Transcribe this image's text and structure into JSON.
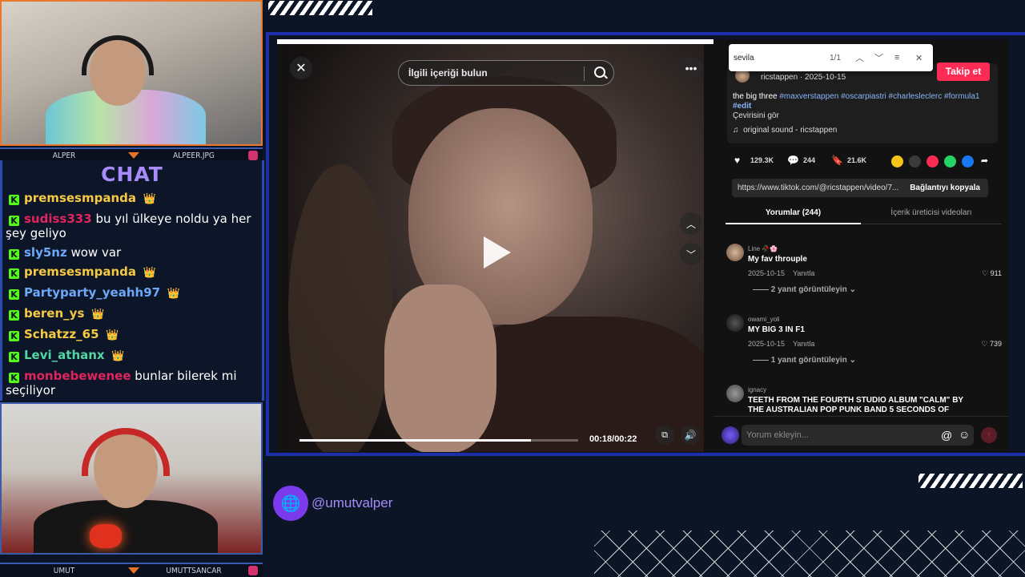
{
  "streamer_top": {
    "name": "ALPER",
    "handle": "ALPEER.JPG"
  },
  "streamer_bottom": {
    "name": "UMUT",
    "handle": "UMUTTSANCAR"
  },
  "chat": {
    "title": "CHAT",
    "messages": [
      {
        "user": "premsesmpanda",
        "text": "",
        "color": "#f6c944"
      },
      {
        "user": "sudiss333",
        "text": "bu yıl ülkeye noldu ya her şey geliyo",
        "color": "#e0245e"
      },
      {
        "user": "sly5nz",
        "text": "wow var",
        "color": "#6ea8f8"
      },
      {
        "user": "premsesmpanda",
        "text": "",
        "color": "#f6c944"
      },
      {
        "user": "Partyparty_yeahh97",
        "text": "",
        "color": "#6ea8f8"
      },
      {
        "user": "beren_ys",
        "text": "",
        "color": "#f6c944"
      },
      {
        "user": "Schatzz_65",
        "text": "",
        "color": "#f6c944"
      },
      {
        "user": "Levi_athanx",
        "text": "",
        "color": "#53d6a3"
      },
      {
        "user": "monbebewenee",
        "text": "bunlar bilerek mi seçiliyor",
        "color": "#e0245e"
      }
    ]
  },
  "video": {
    "search_placeholder": "İlgili içeriği bulun",
    "time": "00:18/00:22",
    "progress": 0.83
  },
  "find_bar": {
    "query": "sevila",
    "count": "1/1"
  },
  "post": {
    "author_date": "ricstappen · 2025-10-15",
    "caption_prefix": "the big three ",
    "hashtags_line1": "#maxverstappen #oscarpiastri #charlesleclerc #formula1",
    "hashtags_line2": "#edit",
    "translate": "Çevirisini gör",
    "sound": "original sound - ricstappen",
    "follow_label": "Takip et",
    "likes": "129.3K",
    "comments": "244",
    "saves": "21.6K",
    "link": "https://www.tiktok.com/@ricstappen/video/7...",
    "copy_link": "Bağlantıyı kopyala"
  },
  "tabs": {
    "comments": "Yorumlar (244)",
    "creator_videos": "İçerik üreticisi videoları"
  },
  "comments": [
    {
      "user": "Line 🥀🌸",
      "text": "My fav throuple",
      "date": "2025-10-15",
      "reply": "Yanıtla",
      "likes": "911",
      "replies": "2 yanıt görüntüleyin"
    },
    {
      "user": "owami_yoli",
      "text": "MY BIG 3 IN F1",
      "date": "2025-10-15",
      "reply": "Yanıtla",
      "likes": "739",
      "replies": "1 yanıt görüntüleyin"
    },
    {
      "user": "ignacy",
      "text": "TEETH FROM THE FOURTH STUDIO ALBUM \"CALM\" BY",
      "text2": "THE AUSTRALIAN POP PUNK BAND 5 SECONDS OF"
    }
  ],
  "compose": {
    "placeholder": "Yorum ekleyin..."
  },
  "overlay": {
    "handle": "@umutvalper"
  }
}
